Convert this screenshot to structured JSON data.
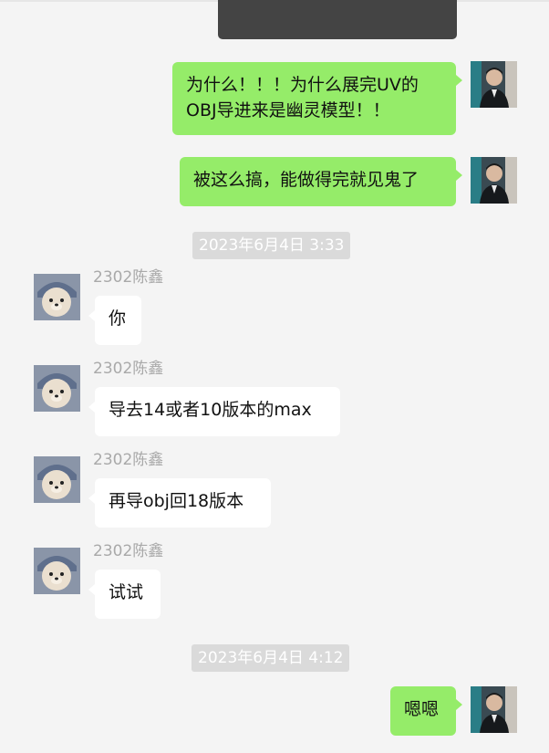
{
  "chat": {
    "messages": [
      {
        "side": "right",
        "text": "为什么！！！为什么展完UV的\nOBJ导进来是幽灵模型！！"
      },
      {
        "side": "right",
        "text": "被这么搞，能做得完就见鬼了"
      },
      {
        "side": "left",
        "sender": "2302陈鑫",
        "text": "你"
      },
      {
        "side": "left",
        "sender": "2302陈鑫",
        "text": "导去14或者10版本的max"
      },
      {
        "side": "left",
        "sender": "2302陈鑫",
        "text": "再导obj回18版本"
      },
      {
        "side": "left",
        "sender": "2302陈鑫",
        "text": "试试"
      },
      {
        "side": "right",
        "text": "嗯嗯"
      }
    ],
    "timestamps": [
      "2023年6月4日 3:33",
      "2023年6月4日 4:12"
    ]
  },
  "colors": {
    "background": "#f4f4f4",
    "self_bubble": "#95ec69",
    "other_bubble": "#ffffff",
    "timestamp_bg": "#dadada",
    "sender_name": "#a9a9a9"
  },
  "icons": {
    "self_avatar": "person-photo-avatar",
    "other_avatar": "teddy-bear-avatar"
  }
}
